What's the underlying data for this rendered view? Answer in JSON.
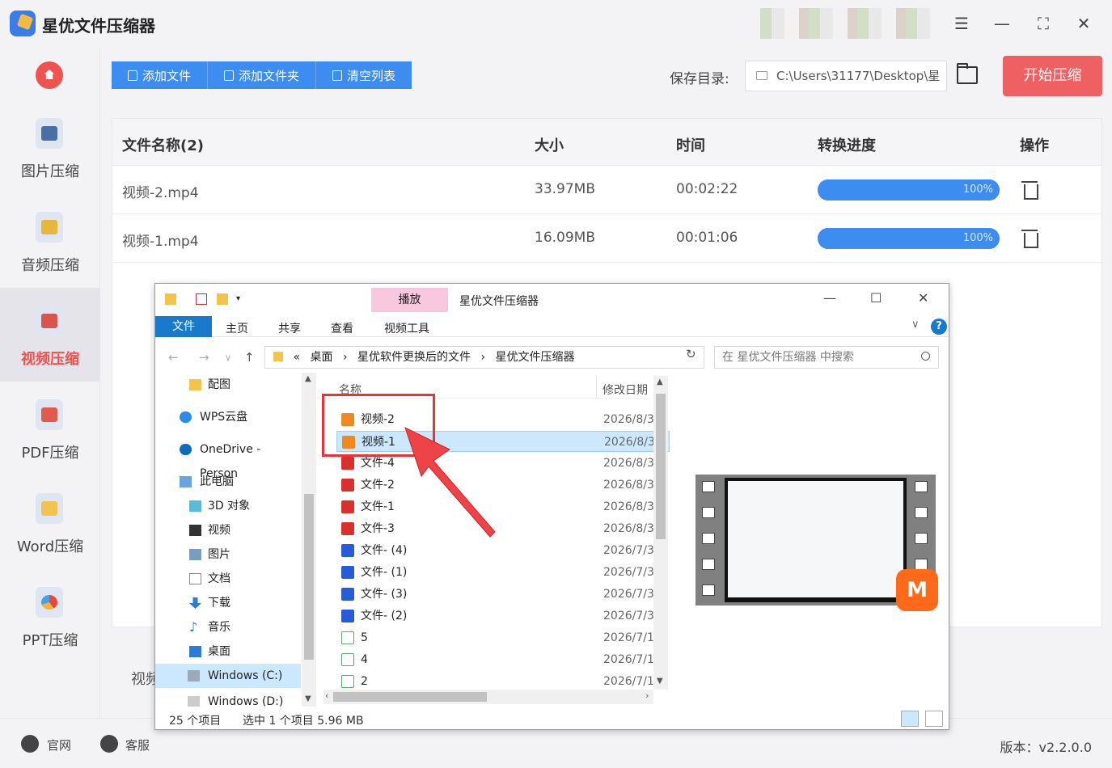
{
  "app": {
    "title": "星优文件压缩器",
    "colors": {
      "accent": "#3d8cf0",
      "start": "#ef6062",
      "active_nav": "#ef5350"
    }
  },
  "sidebar": {
    "items": [
      {
        "label": "图片压缩",
        "icon": "image-icon"
      },
      {
        "label": "音频压缩",
        "icon": "music-icon"
      },
      {
        "label": "视频压缩",
        "icon": "video-icon",
        "active": true
      },
      {
        "label": "PDF压缩",
        "icon": "pdf-icon"
      },
      {
        "label": "Word压缩",
        "icon": "word-icon"
      },
      {
        "label": "PPT压缩",
        "icon": "ppt-icon"
      }
    ]
  },
  "toolbar": {
    "add_file": "添加文件",
    "add_folder": "添加文件夹",
    "clear_list": "清空列表",
    "save_label": "保存目录:",
    "save_path": "C:\\Users\\31177\\Desktop\\星",
    "start": "开始压缩"
  },
  "table": {
    "headers": {
      "name": "文件名称(2)",
      "size": "大小",
      "time": "时间",
      "progress": "转换进度",
      "action": "操作"
    },
    "rows": [
      {
        "name": "视频-2.mp4",
        "size": "33.97MB",
        "time": "00:02:22",
        "progress": "100%",
        "progress_value": 1.0
      },
      {
        "name": "视频-1.mp4",
        "size": "16.09MB",
        "time": "00:01:06",
        "progress": "100%",
        "progress_value": 1.0
      }
    ]
  },
  "status_partial": "视频",
  "bottom": {
    "website": "官网",
    "service": "客服",
    "version": "版本：v2.2.0.0"
  },
  "explorer": {
    "context_tab": "播放",
    "title": "星优文件压缩器",
    "ribbon": {
      "file": "文件",
      "home": "主页",
      "share": "共享",
      "view": "查看",
      "video_tools": "视频工具"
    },
    "breadcrumb": [
      "«",
      "桌面",
      "›",
      "星优软件更换后的文件",
      "›",
      "星优文件压缩器"
    ],
    "search_placeholder": "在 星优文件压缩器 中搜索",
    "nav_items": [
      {
        "label": "配图",
        "icon": "folder-icon"
      },
      {
        "label": "WPS云盘",
        "icon": "cloud-icon"
      },
      {
        "label": "OneDrive - Person",
        "icon": "onedrive-icon"
      },
      {
        "label": "此电脑",
        "icon": "computer-icon"
      },
      {
        "label": "3D 对象",
        "icon": "cube-icon"
      },
      {
        "label": "视频",
        "icon": "film-icon"
      },
      {
        "label": "图片",
        "icon": "picture-icon"
      },
      {
        "label": "文档",
        "icon": "document-icon"
      },
      {
        "label": "下载",
        "icon": "download-icon"
      },
      {
        "label": "音乐",
        "icon": "music-note-icon"
      },
      {
        "label": "桌面",
        "icon": "desktop-icon"
      },
      {
        "label": "Windows (C:)",
        "icon": "drive-icon",
        "selected": true
      },
      {
        "label": "Windows (D:)",
        "icon": "drive-icon"
      }
    ],
    "column_name": "名称",
    "column_date": "修改日期",
    "files": [
      {
        "name": "视频-2",
        "date": "2026/8/3",
        "type": "video"
      },
      {
        "name": "视频-1",
        "date": "2026/8/3",
        "type": "video",
        "selected": true
      },
      {
        "name": "文件-4",
        "date": "2026/8/3",
        "type": "pdf"
      },
      {
        "name": "文件-2",
        "date": "2026/8/3",
        "type": "pdf"
      },
      {
        "name": "文件-1",
        "date": "2026/8/3",
        "type": "pdf"
      },
      {
        "name": "文件-3",
        "date": "2026/8/3",
        "type": "pdf"
      },
      {
        "name": "文件- (4)",
        "date": "2026/7/3",
        "type": "word"
      },
      {
        "name": "文件- (1)",
        "date": "2026/7/3",
        "type": "word"
      },
      {
        "name": "文件- (3)",
        "date": "2026/7/3",
        "type": "word"
      },
      {
        "name": "文件- (2)",
        "date": "2026/7/3",
        "type": "word"
      },
      {
        "name": "5",
        "date": "2026/7/1",
        "type": "excel"
      },
      {
        "name": "4",
        "date": "2026/7/1",
        "type": "excel"
      },
      {
        "name": "2",
        "date": "2026/7/1",
        "type": "excel"
      }
    ],
    "status_count": "25 个项目",
    "status_selected": "选中 1 个项目  5.96 MB"
  }
}
